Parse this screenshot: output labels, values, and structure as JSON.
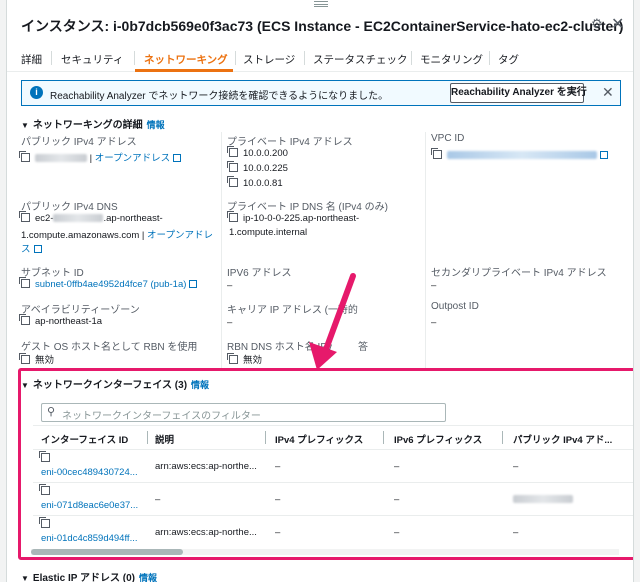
{
  "header": {
    "title": "インスタンス: i-0b7dcb569e0f3ac73 (ECS Instance - EC2ContainerService-hato-ec2-cluster)",
    "icons": [
      "settings-icon",
      "close-icon"
    ]
  },
  "tabs": [
    "詳細",
    "セキュリティ",
    "ネットワーキング",
    "ストレージ",
    "ステータスチェック",
    "モニタリング",
    "タグ"
  ],
  "active_tab": "ネットワーキング",
  "alert": {
    "text": "Reachability Analyzer でネットワーク接続を確認できるようになりました。",
    "button": "Reachability Analyzer を実行",
    "color": "#0073bb"
  },
  "networking": {
    "title": "ネットワーキングの詳細",
    "info": "情報",
    "public_ipv4_label": "パブリック IPv4 アドレス",
    "open_address": "オープンアドレス",
    "private_ipv4_label": "プライベート IPv4 アドレス",
    "private_ipv4_values": [
      "10.0.0.200",
      "10.0.0.225",
      "10.0.0.81"
    ],
    "vpc_label": "VPC ID",
    "public_dns_label": "パブリック IPv4 DNS",
    "public_dns_prefix": "ec2-",
    "public_dns_suffix": ".ap-northeast-",
    "public_dns_line2": "1.compute.amazonaws.com",
    "public_dns_open": "オープンアドレ",
    "public_dns_open2": "ス",
    "private_dns_label": "プライベート IP DNS 名 (IPv4 のみ)",
    "private_dns_line1": "ip-10-0-0-225.ap-northeast-",
    "private_dns_line2": "1.compute.internal",
    "subnet_label": "サブネット ID",
    "subnet_value": "subnet-0ffb4ae4952d4fce7 (pub-1a)",
    "ipv6_label": "IPV6 アドレス",
    "ipv6_value": "–",
    "secondary_label": "セカンダリプライベート IPv4 アドレス",
    "secondary_value": "–",
    "az_label": "アベイラビリティーゾーン",
    "az_value": "ap-northeast-1a",
    "carrier_label": "キャリア IP アドレス (一時的",
    "carrier_value": "–",
    "outpost_label": "Outpost ID",
    "outpost_value": "–",
    "guest_os_label": "ゲスト OS ホスト名として RBN を使用",
    "guest_os_value": "無効",
    "rbn_label": "RBN DNS ホスト名 IPv",
    "rbn_label_tail": "答",
    "rbn_value": "無効"
  },
  "eni": {
    "title": "ネットワークインターフェイス (3)",
    "info": "情報",
    "search_placeholder": "ネットワークインターフェイスのフィルター",
    "columns": [
      "インターフェイス ID",
      "説明",
      "IPv4 プレフィックス",
      "IPv6 プレフィックス",
      "パブリック IPv4 アド..."
    ],
    "rows": [
      {
        "id": "eni-00cec489430724...",
        "desc": "arn:aws:ecs:ap-northe...",
        "ipv4p": "–",
        "ipv6p": "–",
        "pub": "–"
      },
      {
        "id": "eni-071d8eac6e0e37...",
        "desc": "–",
        "ipv4p": "–",
        "ipv6p": "–",
        "pub": ""
      },
      {
        "id": "eni-01dc4c859d494ff...",
        "desc": "arn:aws:ecs:ap-northe...",
        "ipv4p": "–",
        "ipv6p": "–",
        "pub": "–"
      }
    ],
    "highlight_color": "#e6196b"
  },
  "elastic_ip": {
    "title": "Elastic IP アドレス (0)",
    "info": "情報"
  }
}
